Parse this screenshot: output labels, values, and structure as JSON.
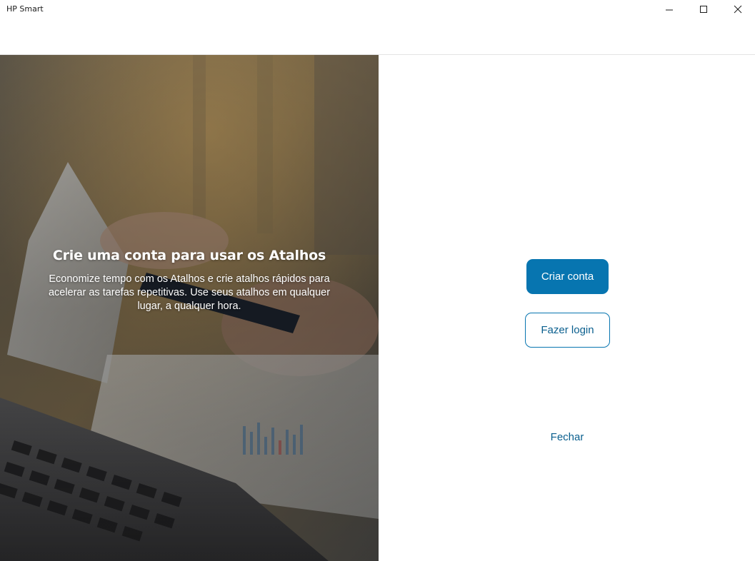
{
  "window": {
    "app_title": "HP Smart",
    "controls": {
      "minimize": "minimize-icon",
      "maximize": "maximize-icon",
      "close": "close-icon"
    }
  },
  "hero": {
    "heading": "Crie uma conta para usar os Atalhos",
    "body": "Economize tempo com os Atalhos e crie atalhos rápidos para acelerar as tarefas repetitivas. Use seus atalhos em qualquer lugar, a qualquer hora."
  },
  "actions": {
    "create_account_label": "Criar conta",
    "login_label": "Fazer login",
    "close_label": "Fechar"
  },
  "colors": {
    "primary": "#0775b0",
    "link": "#0a5f8e"
  }
}
